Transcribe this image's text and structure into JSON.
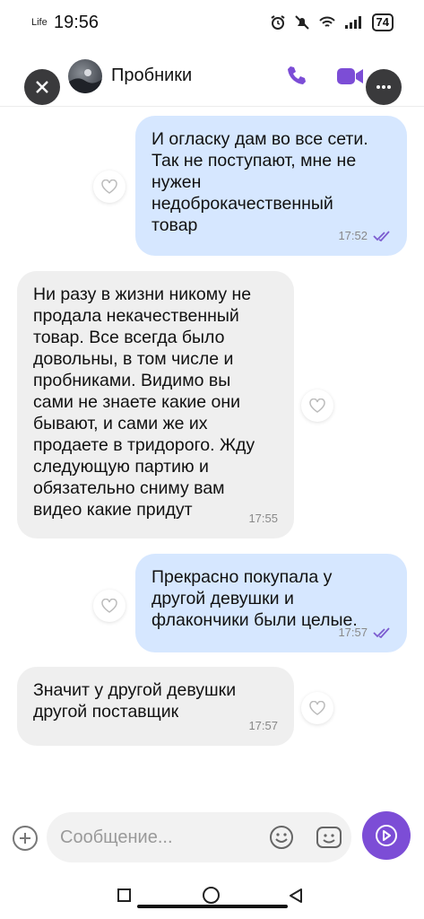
{
  "status_bar": {
    "carrier": "Life",
    "time": "19:56",
    "battery": "74"
  },
  "header": {
    "title": "Пробники"
  },
  "messages": [
    {
      "direction": "outgoing",
      "text": "И огласку дам во все сети.\nТак не поступают, мне не\nнужен\nнедоброкачественный\nтовар",
      "time": "17:52",
      "read": true
    },
    {
      "direction": "incoming",
      "text": "Ни разу в жизни никому не\nпродала некачественный\nтовар. Все всегда было\nдовольны, в том числе и\nпробниками. Видимо вы\nсами не знаете какие они\nбывают, и сами же их\nпродаете в тридорого. Жду\nследующую партию и\nобязательно сниму вам\nвидео какие придут",
      "time": "17:55"
    },
    {
      "direction": "outgoing",
      "text": "Прекрасно покупала у\nдругой девушки и\nфлакончики были целые.",
      "time": "17:57",
      "read": true
    },
    {
      "direction": "incoming",
      "text": "Значит у другой девушки\nдругой поставщик",
      "time": "17:57"
    }
  ],
  "composer": {
    "placeholder": "Сообщение..."
  },
  "colors": {
    "outgoing_bubble": "#d6e7ff",
    "incoming_bubble": "#efefef",
    "accent": "#7c4dd6"
  }
}
